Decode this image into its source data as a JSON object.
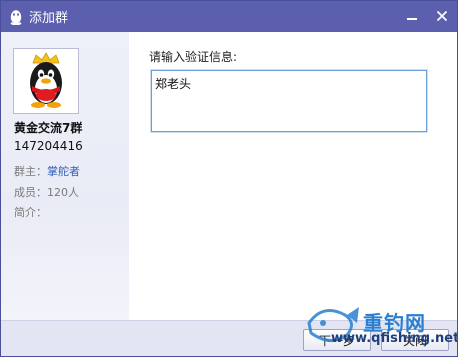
{
  "window": {
    "title": "添加群",
    "icon": "qq-penguin-icon"
  },
  "titlebar": {
    "minimize_label": "−",
    "close_label": "✕"
  },
  "group": {
    "name": "黄金交流7群",
    "id": "147204416",
    "owner_label": "群主：",
    "owner_name": "掌舵者",
    "members_label": "成员：",
    "members_count": "120人",
    "intro_label": "简介："
  },
  "form": {
    "prompt": "请输入验证信息:",
    "value": "郑老头"
  },
  "buttons": {
    "next": "下一步",
    "close": "关闭"
  },
  "watermark": {
    "brand": "重钓网",
    "url": "www.qfishing.net"
  },
  "colors": {
    "titlebar": "#5b5fae",
    "sidebar": "#eef0f9",
    "footer": "#e3e5f3",
    "link": "#2f5fb8",
    "input_border": "#6a9fd8"
  }
}
